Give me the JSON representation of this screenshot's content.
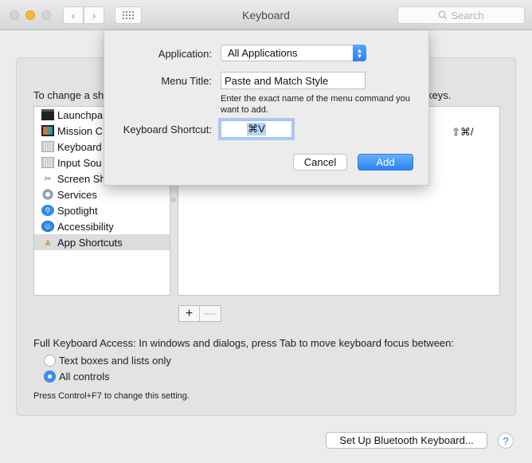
{
  "window": {
    "title": "Keyboard",
    "search_placeholder": "Search",
    "nav_back": "‹",
    "nav_forward": "›"
  },
  "pane": {
    "instructions_visible": "To change a sh",
    "instructions_tail": "keys.",
    "categories": [
      {
        "label": "Launchpa",
        "icon": "launchpad-icon",
        "selected": false
      },
      {
        "label": "Mission C",
        "icon": "mission-control-icon",
        "selected": false
      },
      {
        "label": "Keyboard",
        "icon": "keyboard-icon",
        "selected": false
      },
      {
        "label": "Input Sou",
        "icon": "input-sources-icon",
        "selected": false
      },
      {
        "label": "Screen Sh",
        "icon": "screenshot-icon",
        "selected": false
      },
      {
        "label": "Services",
        "icon": "services-gear-icon",
        "selected": false
      },
      {
        "label": "Spotlight",
        "icon": "spotlight-icon",
        "selected": false
      },
      {
        "label": "Accessibility",
        "icon": "accessibility-icon",
        "selected": false
      },
      {
        "label": "App Shortcuts",
        "icon": "app-shortcuts-icon",
        "selected": true
      }
    ],
    "shortcut_key_visible": "⇧⌘/",
    "add_label": "+",
    "remove_label": "—",
    "full_keyboard_access": "Full Keyboard Access: In windows and dialogs, press Tab to move keyboard focus between:",
    "radio_options": [
      {
        "label": "Text boxes and lists only",
        "checked": false
      },
      {
        "label": "All controls",
        "checked": true
      }
    ],
    "hint": "Press Control+F7 to change this setting.",
    "bluetooth_button": "Set Up Bluetooth Keyboard...",
    "help_button": "?"
  },
  "sheet": {
    "application_label": "Application:",
    "application_value": "All Applications",
    "menu_title_label": "Menu Title:",
    "menu_title_value": "Paste and Match Style",
    "menu_title_help": "Enter the exact name of the menu command you want to add.",
    "shortcut_label": "Keyboard Shortcut:",
    "shortcut_value": "⌘V",
    "cancel_label": "Cancel",
    "add_label": "Add"
  },
  "colors": {
    "accent": "#3c8ef5",
    "traffic_minimize": "#f6b73c"
  }
}
